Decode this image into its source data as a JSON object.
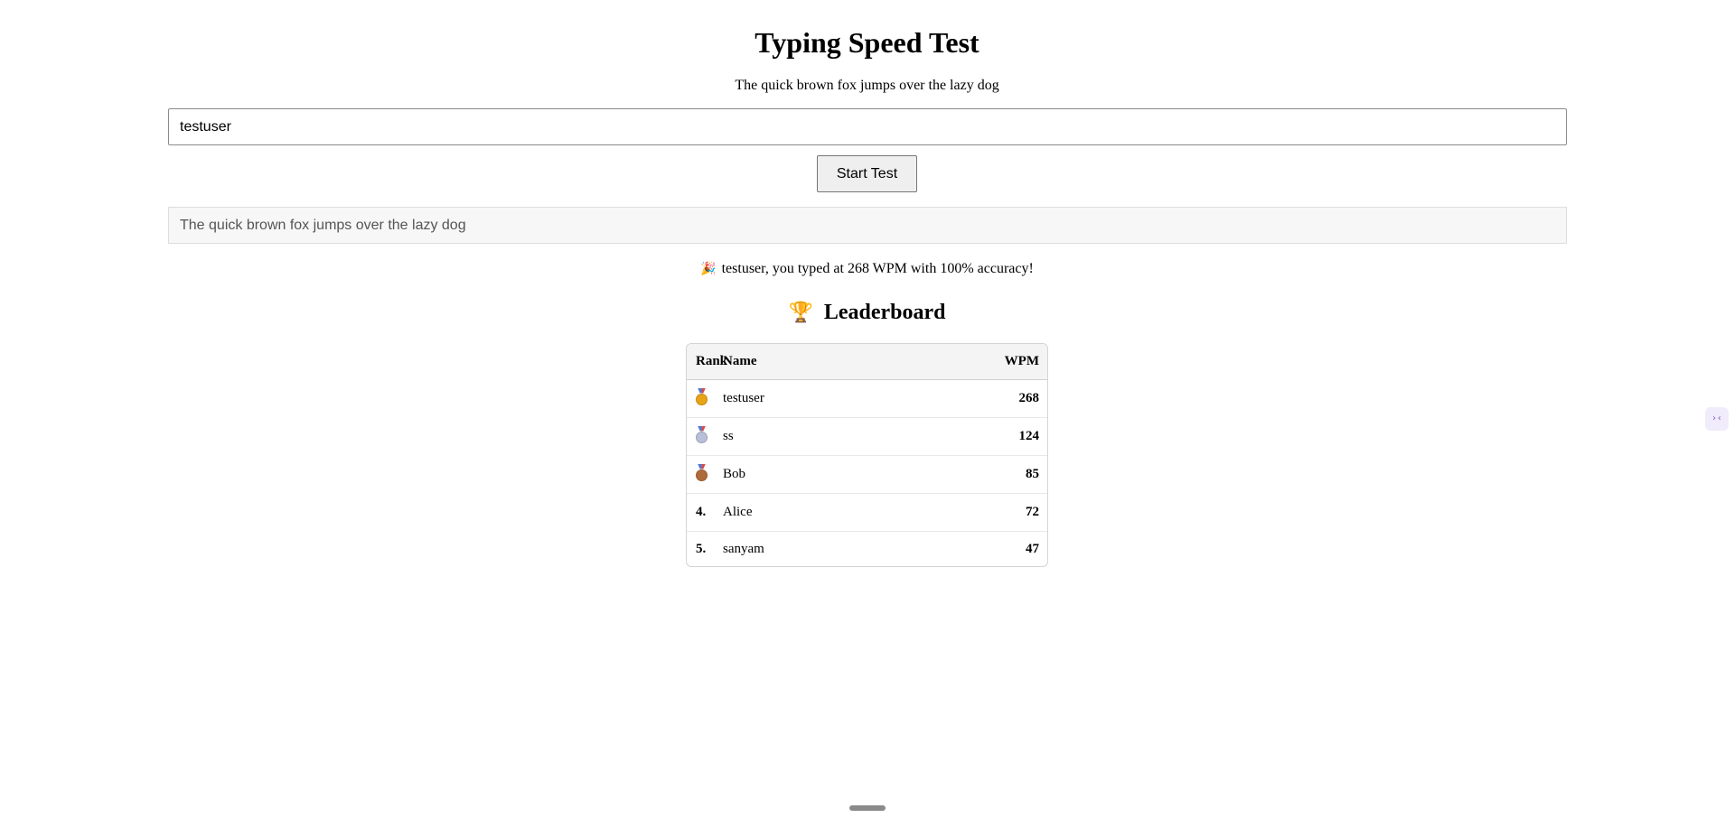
{
  "app": {
    "title": "Typing Speed Test",
    "sentence": "The quick brown fox jumps over the lazy dog"
  },
  "form": {
    "username_value": "testuser",
    "start_button_label": "Start Test"
  },
  "typing_area": {
    "text": "The quick brown fox jumps over the lazy dog"
  },
  "result": {
    "icon": "party-popper-icon",
    "emoji": "🎉",
    "message": "testuser, you typed at 268 WPM with 100% accuracy!"
  },
  "leaderboard": {
    "icon": "trophy-icon",
    "emoji": "🏆",
    "heading": "Leaderboard",
    "columns": {
      "rank": "Rank",
      "name": "Name",
      "wpm": "WPM"
    },
    "rows": [
      {
        "rank": "",
        "medal": "gold",
        "medal_color": "#e8a317",
        "name": "testuser",
        "wpm": "268"
      },
      {
        "rank": "",
        "medal": "silver",
        "medal_color": "#b8bfd8",
        "name": "ss",
        "wpm": "124"
      },
      {
        "rank": "",
        "medal": "bronze",
        "medal_color": "#b06b3a",
        "name": "Bob",
        "wpm": "85"
      },
      {
        "rank": "4.",
        "medal": "",
        "name": "Alice",
        "wpm": "72"
      },
      {
        "rank": "5.",
        "medal": "",
        "name": "sanyam",
        "wpm": "47"
      }
    ]
  },
  "side_widget": {
    "icon": "collapse-arrows-icon",
    "glyph": "›‹"
  }
}
